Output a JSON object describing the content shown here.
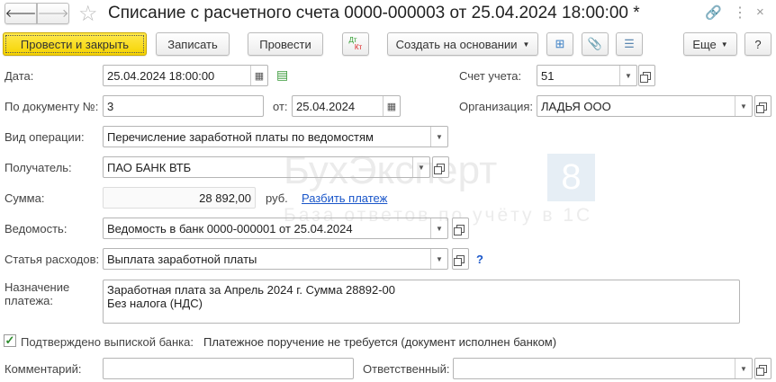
{
  "window": {
    "title": "Списание с расчетного счета 0000-000003 от 25.04.2024 18:00:00 *"
  },
  "toolbar": {
    "post_close": "Провести и закрыть",
    "save": "Записать",
    "post": "Провести",
    "dtkt_top": "Дт",
    "dtkt_bottom": "Кт",
    "create_based": "Создать на основании",
    "more": "Еще",
    "help": "?"
  },
  "form": {
    "date_label": "Дата:",
    "date_value": "25.04.2024 18:00:00",
    "account_label": "Счет учета:",
    "account_value": "51",
    "docnum_label": "По документу №:",
    "docnum_value": "3",
    "from_label": "от:",
    "from_value": "25.04.2024",
    "org_label": "Организация:",
    "org_value": "ЛАДЬЯ ООО",
    "optype_label": "Вид операции:",
    "optype_value": "Перечисление заработной платы по ведомостям",
    "recipient_label": "Получатель:",
    "recipient_value": "ПАО БАНК ВТБ",
    "sum_label": "Сумма:",
    "sum_value": "28 892,00",
    "currency": "руб.",
    "split_link": "Разбить платеж",
    "statement_label": "Ведомость:",
    "statement_value": "Ведомость в банк 0000-000001 от 25.04.2024",
    "expense_label": "Статья расходов:",
    "expense_value": "Выплата заработной платы",
    "expense_help": "?",
    "purpose_label": "Назначение платежа:",
    "purpose_line1": "Заработная плата за Апрель 2024 г. Сумма 28892-00",
    "purpose_line2": "Без налога (НДС)",
    "confirmed_label": "Подтверждено выпиской банка:",
    "confirmed_checked": true,
    "confirmed_note": "Платежное поручение не требуется (документ исполнен банком)",
    "comment_label": "Комментарий:",
    "comment_value": "",
    "responsible_label": "Ответственный:",
    "responsible_value": ""
  },
  "watermark": {
    "brand": "БухЭксперт",
    "badge": "8",
    "tagline": "База ответов по учёту в 1С"
  },
  "colors": {
    "primary_button": "#f5d300",
    "link": "#1a56c9",
    "checkbox": "#2e8b2e"
  }
}
